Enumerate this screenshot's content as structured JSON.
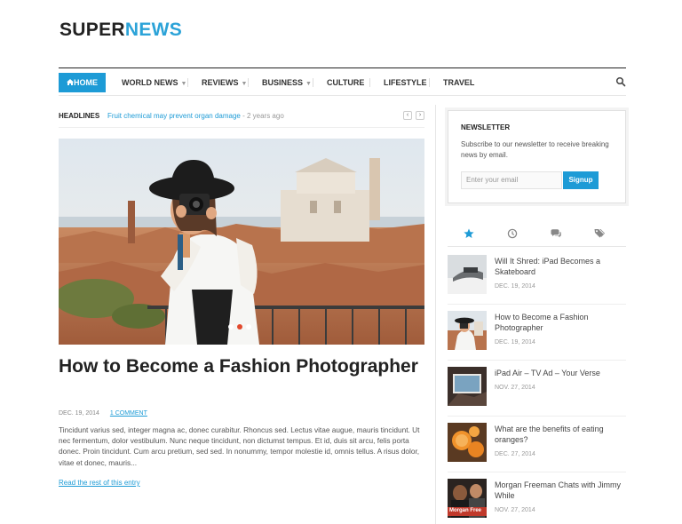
{
  "logo": {
    "part1": "SUPER",
    "part2": "NEWS"
  },
  "nav": {
    "items": [
      {
        "label": "Home",
        "icon": "home-icon"
      },
      {
        "label": "World News",
        "dropdown": true
      },
      {
        "label": "Reviews",
        "dropdown": true
      },
      {
        "label": "Business",
        "dropdown": true
      },
      {
        "label": "Culture"
      },
      {
        "label": "Lifestyle"
      },
      {
        "label": "Travel"
      }
    ],
    "search_icon": "search-icon"
  },
  "headlines": {
    "label": "HEADLINES",
    "title": "Fruit chemical may prevent organ damage",
    "ago": " - 2 years ago",
    "prev": "‹",
    "next": "›"
  },
  "hero": {
    "slides": 3,
    "active_slide": 2
  },
  "article": {
    "title": "How to Become a Fashion Photographer",
    "date": "DEC. 19, 2014",
    "comments": "1 COMMENT",
    "excerpt": "Tincidunt varius sed, integer magna ac, donec curabitur. Rhoncus sed. Lectus vitae augue, mauris tincidunt. Ut nec fermentum, dolor vestibulum. Nunc neque tincidunt, non dictumst tempus. Et id, duis sit arcu, felis porta donec. Proin tincidunt. Cum arcu pretium, sed sed. In nonummy, tempor molestie id, omnis tellus. A risus dolor, vitae et donec, mauris...",
    "read_more": "Read the rest of this entry"
  },
  "newsletter": {
    "heading": "NEWSLETTER",
    "description": "Subscribe to our newsletter to receive breaking news by email.",
    "placeholder": "Enter your email",
    "button": "Signup"
  },
  "sidebar_tabs": [
    "star-icon",
    "clock-icon",
    "comments-icon",
    "tags-icon"
  ],
  "posts": [
    {
      "title": "Will It Shred: iPad Becomes a Skateboard",
      "date": "DEC. 19, 2014"
    },
    {
      "title": "How to Become a Fashion Photographer",
      "date": "DEC. 19, 2014"
    },
    {
      "title": "iPad Air – TV Ad – Your Verse",
      "date": "NOV. 27, 2014"
    },
    {
      "title": "What are the benefits of eating oranges?",
      "date": "DEC. 27, 2014"
    },
    {
      "title": "Morgan Freeman Chats with Jimmy While",
      "date": "NOV. 27, 2014",
      "thumb_caption": "Morgan Free"
    }
  ],
  "colors": {
    "accent": "#1d9bd6",
    "logo_dark": "#222222",
    "logo_blue": "#2ca3d8",
    "slider_active": "#e24a2e"
  }
}
